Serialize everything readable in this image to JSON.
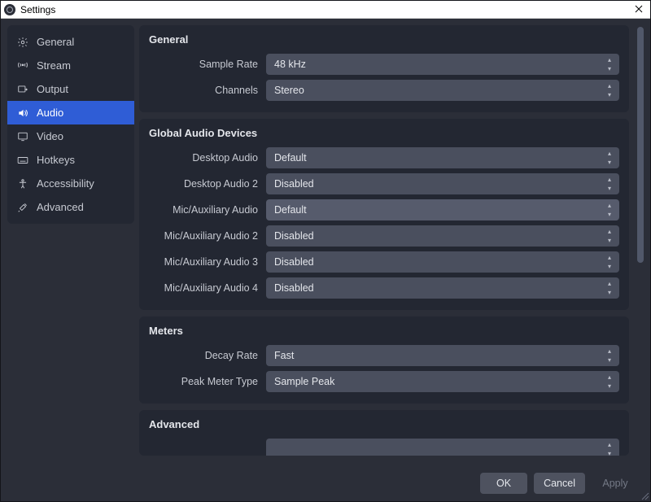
{
  "window": {
    "title": "Settings"
  },
  "sidebar": {
    "items": [
      {
        "label": "General",
        "icon": "gear-icon"
      },
      {
        "label": "Stream",
        "icon": "antenna-icon"
      },
      {
        "label": "Output",
        "icon": "output-icon"
      },
      {
        "label": "Audio",
        "icon": "speaker-icon"
      },
      {
        "label": "Video",
        "icon": "monitor-icon"
      },
      {
        "label": "Hotkeys",
        "icon": "keyboard-icon"
      },
      {
        "label": "Accessibility",
        "icon": "accessibility-icon"
      },
      {
        "label": "Advanced",
        "icon": "tools-icon"
      }
    ],
    "selected_index": 3
  },
  "content": {
    "general": {
      "title": "General",
      "sample_rate": {
        "label": "Sample Rate",
        "value": "48 kHz"
      },
      "channels": {
        "label": "Channels",
        "value": "Stereo"
      }
    },
    "devices": {
      "title": "Global Audio Devices",
      "desktop_audio": {
        "label": "Desktop Audio",
        "value": "Default"
      },
      "desktop_audio_2": {
        "label": "Desktop Audio 2",
        "value": "Disabled"
      },
      "mic_aux": {
        "label": "Mic/Auxiliary Audio",
        "value": "Default"
      },
      "mic_aux_2": {
        "label": "Mic/Auxiliary Audio 2",
        "value": "Disabled"
      },
      "mic_aux_3": {
        "label": "Mic/Auxiliary Audio 3",
        "value": "Disabled"
      },
      "mic_aux_4": {
        "label": "Mic/Auxiliary Audio 4",
        "value": "Disabled"
      }
    },
    "meters": {
      "title": "Meters",
      "decay_rate": {
        "label": "Decay Rate",
        "value": "Fast"
      },
      "peak_meter_type": {
        "label": "Peak Meter Type",
        "value": "Sample Peak"
      }
    },
    "advanced": {
      "title": "Advanced"
    }
  },
  "footer": {
    "ok": "OK",
    "cancel": "Cancel",
    "apply": "Apply"
  }
}
